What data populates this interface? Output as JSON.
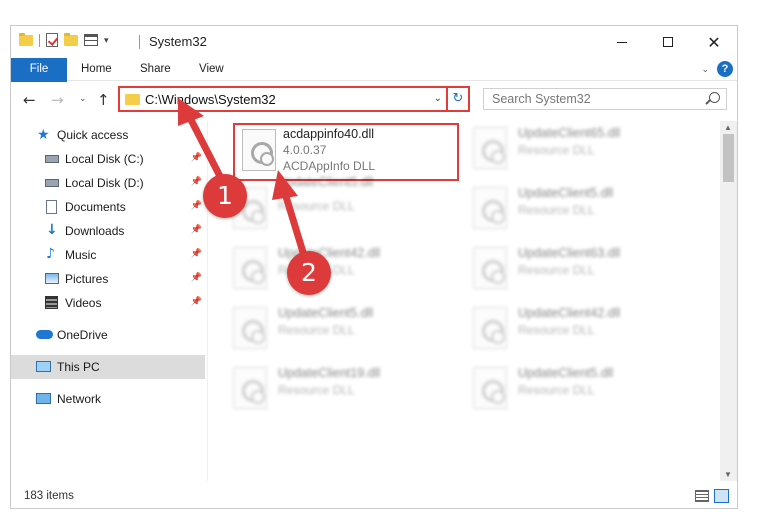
{
  "window": {
    "title": "System32"
  },
  "ribbon": {
    "file": "File",
    "home": "Home",
    "share": "Share",
    "view": "View",
    "help": "?"
  },
  "navigation": {
    "back": "←",
    "forward": "→",
    "recent": "⌄",
    "up": "↑",
    "address": "C:\\Windows\\System32",
    "search_placeholder": "Search System32"
  },
  "sidebar": {
    "items": [
      {
        "label": "Quick access",
        "icon": "star-icon"
      },
      {
        "label": "Local Disk (C:)",
        "icon": "disk-icon"
      },
      {
        "label": "Local Disk (D:)",
        "icon": "disk-icon"
      },
      {
        "label": "Documents",
        "icon": "document-icon"
      },
      {
        "label": "Downloads",
        "icon": "download-icon"
      },
      {
        "label": "Music",
        "icon": "music-icon"
      },
      {
        "label": "Pictures",
        "icon": "pictures-icon"
      },
      {
        "label": "Videos",
        "icon": "videos-icon"
      },
      {
        "label": "OneDrive",
        "icon": "cloud-icon"
      },
      {
        "label": "This PC",
        "icon": "computer-icon"
      },
      {
        "label": "Network",
        "icon": "network-icon"
      }
    ]
  },
  "files": {
    "highlighted": {
      "name": "acdappinfo40.dll",
      "version": "4.0.0.37",
      "description": "ACDAppInfo DLL"
    },
    "left_column": [
      {
        "name": "",
        "description": "Resource DLL"
      },
      {
        "name": "UpdateClient42.dll",
        "description": "Resource DLL"
      },
      {
        "name": "UpdateClient5.dll",
        "description": "Resource DLL"
      },
      {
        "name": "UpdateClient19.dll",
        "description": "Resource DLL"
      }
    ],
    "right_column": [
      {
        "name": "UpdateClient65.dll",
        "description": "Resource DLL"
      },
      {
        "name": "UpdateClient5.dll",
        "description": "Resource DLL"
      },
      {
        "name": "UpdateClient63.dll",
        "description": "Resource DLL"
      },
      {
        "name": "UpdateClient42.dll",
        "description": "Resource DLL"
      },
      {
        "name": "UpdateClient5.dll",
        "description": "Resource DLL"
      }
    ],
    "partial_left_label": "UpdateClient5.dll"
  },
  "status": {
    "count": "183 items"
  },
  "annotations": {
    "step1": "1",
    "step2": "2",
    "color": "#dd3b3b"
  },
  "colors": {
    "accent": "#1a6fc4",
    "highlight_border": "#e13c3c"
  }
}
